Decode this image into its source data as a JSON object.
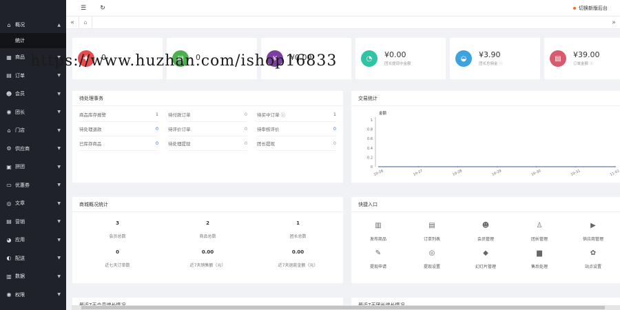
{
  "sidebar": {
    "items": [
      {
        "label": "概况",
        "icon": "home-icon",
        "glyph": "⌂",
        "arrow": "▲"
      },
      {
        "label": "统计",
        "sub": true
      },
      {
        "label": "商品",
        "icon": "goods-icon",
        "glyph": "▦",
        "arrow": "▼"
      },
      {
        "label": "订单",
        "icon": "order-icon",
        "glyph": "▤",
        "arrow": "▼"
      },
      {
        "label": "会员",
        "icon": "member-icon",
        "glyph": "☻",
        "arrow": "▼"
      },
      {
        "label": "团长",
        "icon": "leader-icon",
        "glyph": "◉",
        "arrow": "▼"
      },
      {
        "label": "门店",
        "icon": "store-icon",
        "glyph": "⌂",
        "arrow": "▼"
      },
      {
        "label": "供应商",
        "icon": "supplier-icon",
        "glyph": "⚙",
        "arrow": "▼"
      },
      {
        "label": "拼团",
        "icon": "group-icon",
        "glyph": "▣",
        "arrow": "▼"
      },
      {
        "label": "优惠券",
        "icon": "coupon-icon",
        "glyph": "▭",
        "arrow": "▼"
      },
      {
        "label": "文章",
        "icon": "article-icon",
        "glyph": "◎",
        "arrow": "▼"
      },
      {
        "label": "营销",
        "icon": "marketing-icon",
        "glyph": "▤",
        "arrow": "▼"
      },
      {
        "label": "应用",
        "icon": "app-icon",
        "glyph": "◕",
        "arrow": "▼"
      },
      {
        "label": "配送",
        "icon": "delivery-icon",
        "glyph": "◐",
        "arrow": "▼"
      },
      {
        "label": "数据",
        "icon": "data-icon",
        "glyph": "▥",
        "arrow": "▼"
      },
      {
        "label": "权限",
        "icon": "permission-icon",
        "glyph": "◉",
        "arrow": "▼"
      }
    ]
  },
  "topbar": {
    "menu_glyph": "☰",
    "refresh_glyph": "↻",
    "switch_label": "切换新版后台"
  },
  "tabs": {
    "left_glyph": "«",
    "home_glyph": "⌂",
    "right_glyph": "»"
  },
  "stats": [
    {
      "value": "0",
      "label": "",
      "color": "#e84b4b",
      "icon": "cart-icon",
      "glyph": "✚"
    },
    {
      "value": "0",
      "label": "",
      "color": "#4caf50",
      "icon": "document-icon",
      "glyph": "▤"
    },
    {
      "value": "¥0.00",
      "label": "",
      "color": "#7b3fa0",
      "icon": "money-icon",
      "glyph": "¥"
    },
    {
      "value": "¥0.00",
      "label": "团长提现中金额",
      "color": "#2ec4a6",
      "icon": "pie-icon",
      "glyph": "◔"
    },
    {
      "value": "¥3.90",
      "label": "团长总佣金 ⓘ",
      "color": "#3fa2e0",
      "icon": "bag-icon",
      "glyph": "◒"
    },
    {
      "value": "¥39.00",
      "label": "订单金额 ⓘ",
      "color": "#d9596d",
      "icon": "list-icon",
      "glyph": "▤"
    }
  ],
  "watermark": "https://www.huzhan.com/ishop16833",
  "todo": {
    "title": "待处理事务",
    "items": [
      {
        "label": "商品库存报警",
        "value": "1",
        "blue": true
      },
      {
        "label": "待付款订单",
        "value": "0",
        "blue": false
      },
      {
        "label": "待买中订单 ⓘ",
        "value": "1",
        "blue": true
      },
      {
        "label": "待处理退款",
        "value": "0",
        "blue": true
      },
      {
        "label": "待评价订单",
        "value": "0",
        "blue": false
      },
      {
        "label": "待审核评价",
        "value": "0",
        "blue": true
      },
      {
        "label": "已库存商品",
        "value": "0",
        "blue": true
      },
      {
        "label": "待处理提现",
        "value": "0",
        "blue": false
      },
      {
        "label": "团长提现",
        "value": "0",
        "blue": false
      }
    ]
  },
  "trade": {
    "title": "交易统计",
    "legend": "金额"
  },
  "chart_data": {
    "type": "line",
    "title": "交易统计",
    "ylabel": "金额",
    "x": [
      "10-26",
      "10-27",
      "10-28",
      "10-29",
      "10-30",
      "10-31",
      "11-01"
    ],
    "series": [
      {
        "values": [
          0,
          0,
          0,
          0,
          0,
          0,
          0
        ]
      }
    ],
    "yticks": [
      "0",
      "0.2",
      "0.4",
      "0.6",
      "0.8",
      "1"
    ],
    "ylim": [
      0,
      1
    ],
    "line_color": "#3b5b9e"
  },
  "mall": {
    "title": "商城概况统计",
    "cells": [
      {
        "value": "3",
        "label": "会员总数"
      },
      {
        "value": "2",
        "label": "商品总数"
      },
      {
        "value": "1",
        "label": "团长总数"
      },
      {
        "value": "0",
        "label": "近七天订单数"
      },
      {
        "value": "0.00",
        "label": "近7天销售额（元）"
      },
      {
        "value": "0.00",
        "label": "近7天退款金额（元）"
      }
    ]
  },
  "quick": {
    "title": "快捷入口",
    "items": [
      {
        "label": "发布商品",
        "icon": "barcode-icon",
        "glyph": "▥"
      },
      {
        "label": "订单列表",
        "icon": "clipboard-icon",
        "glyph": "▤"
      },
      {
        "label": "会员管理",
        "icon": "user-icon",
        "glyph": "☻"
      },
      {
        "label": "团长管理",
        "icon": "org-icon",
        "glyph": "♙"
      },
      {
        "label": "供应商管理",
        "icon": "truck-icon",
        "glyph": "▶"
      },
      {
        "label": "提现申请",
        "icon": "ticket-icon",
        "glyph": "✎"
      },
      {
        "label": "提现设置",
        "icon": "coin-icon",
        "glyph": "◎"
      },
      {
        "label": "幻灯片管理",
        "icon": "tag-icon",
        "glyph": "◆"
      },
      {
        "label": "售后处理",
        "icon": "bars-icon",
        "glyph": "▆"
      },
      {
        "label": "站点设置",
        "icon": "gear-icon",
        "glyph": "✿"
      }
    ]
  },
  "bottom_panels": [
    "最近7天会员增长情况",
    "最近7天团长增长情况"
  ]
}
